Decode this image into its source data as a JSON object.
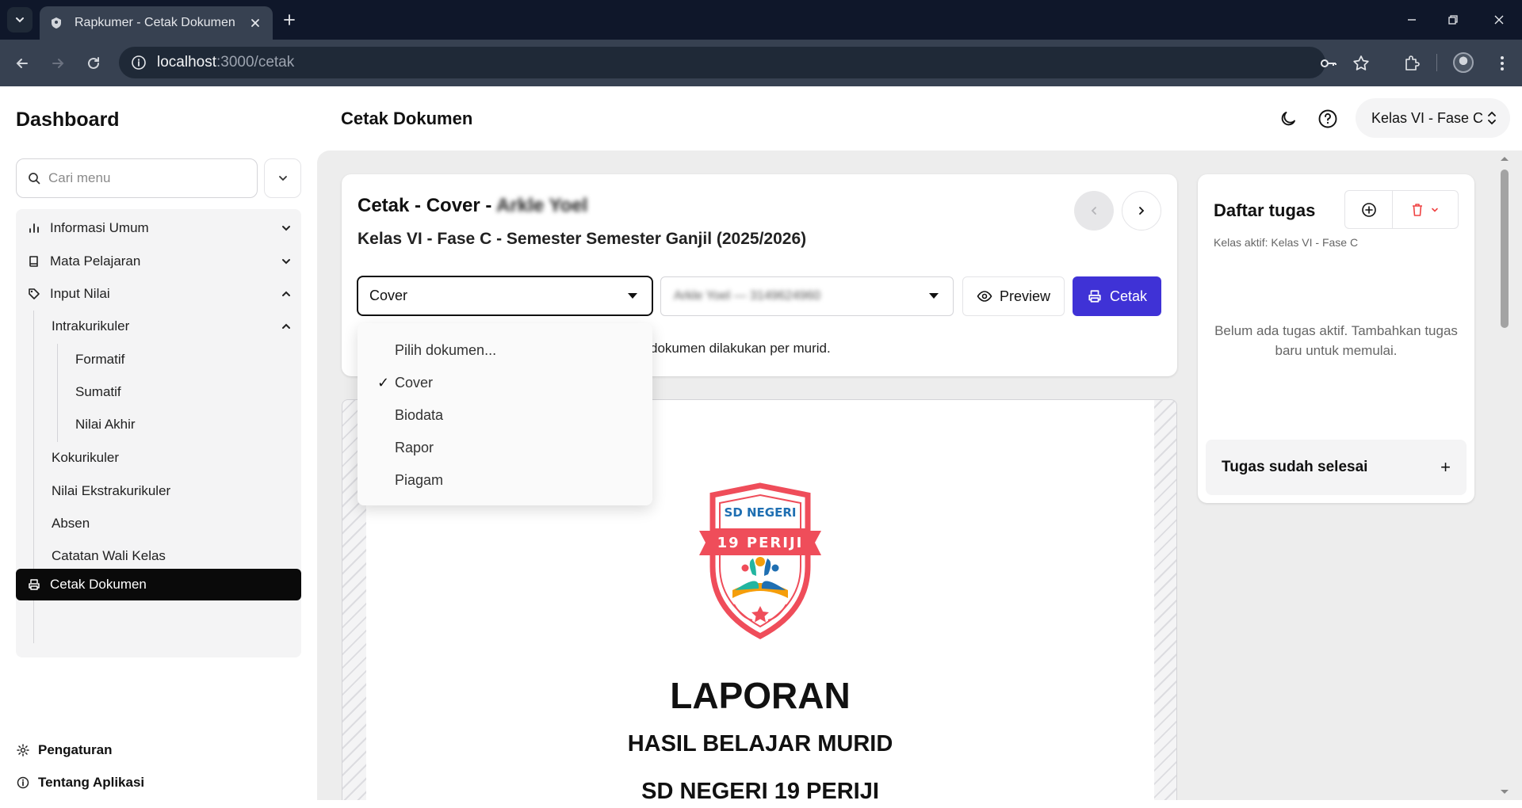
{
  "browser": {
    "tab_title": "Rapkumer - Cetak Dokumen",
    "url_host": "localhost",
    "url_path": ":3000/cetak"
  },
  "sidebar": {
    "title": "Dashboard",
    "search_placeholder": "Cari menu",
    "items": [
      {
        "label": "Informasi Umum",
        "icon": "bar-chart-icon"
      },
      {
        "label": "Mata Pelajaran",
        "icon": "book-icon"
      },
      {
        "label": "Input Nilai",
        "icon": "tag-icon"
      },
      {
        "label": "Intrakurikuler"
      },
      {
        "label": "Formatif"
      },
      {
        "label": "Sumatif"
      },
      {
        "label": "Nilai Akhir"
      },
      {
        "label": "Kokurikuler"
      },
      {
        "label": "Nilai Ekstrakurikuler"
      },
      {
        "label": "Absen"
      },
      {
        "label": "Catatan Wali Kelas"
      }
    ],
    "active_item": "Cetak Dokumen",
    "footer": {
      "settings": "Pengaturan",
      "about": "Tentang Aplikasi"
    }
  },
  "header": {
    "title": "Cetak Dokumen",
    "class_selector": "Kelas VI - Fase C"
  },
  "main_card": {
    "title_prefix": "Cetak - Cover - ",
    "student_name": "Arkle Yoel",
    "subtitle": "Kelas VI - Fase C - Semester Semester Ganjil (2025/2026)",
    "doc_select_value": "Cover",
    "student_select_value": "Arkle Yoel — 3149624960",
    "preview_label": "Preview",
    "print_label": "Cetak",
    "note_visible": "dokumen dilakukan per murid."
  },
  "dropdown": {
    "options": [
      "Pilih dokumen...",
      "Cover",
      "Biodata",
      "Rapor",
      "Piagam"
    ],
    "selected": "Cover",
    "check_glyph": "✓"
  },
  "document_preview": {
    "logo_school_top": "SD NEGERI",
    "logo_school_banner": "19 PERIJI",
    "heading": "LAPORAN",
    "subheading": "HASIL BELAJAR MURID",
    "school": "SD NEGERI 19 PERIJI"
  },
  "tasks": {
    "title": "Daftar tugas",
    "active_class": "Kelas aktif: Kelas VI - Fase C",
    "empty_text": "Belum ada tugas aktif. Tambahkan tugas baru untuk memulai.",
    "done_label": "Tugas sudah selesai",
    "done_toggle": "+"
  },
  "colors": {
    "primary": "#3f32d6",
    "danger": "#ef4444",
    "sidebar_active": "#0a0a0a",
    "logo_red": "#ef4d5a",
    "logo_blue": "#1f6fb2"
  }
}
